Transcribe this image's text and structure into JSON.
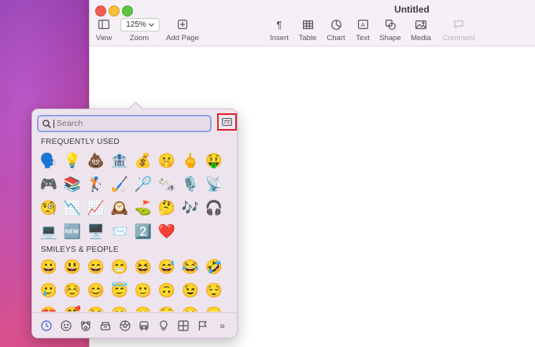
{
  "window": {
    "title": "Untitled"
  },
  "toolbar": {
    "view_label": "View",
    "zoom_value": "125%",
    "zoom_label": "Zoom",
    "add_page_label": "Add Page",
    "insert_label": "Insert",
    "table_label": "Table",
    "chart_label": "Chart",
    "text_label": "Text",
    "shape_label": "Shape",
    "media_label": "Media",
    "comment_label": "Comment"
  },
  "picker": {
    "search_placeholder": "Search",
    "frequently_used_header": "FREQUENTLY USED",
    "smileys_header": "SMILEYS & PEOPLE",
    "frequently_used": [
      "🗣️",
      "💡",
      "💩",
      "🏦",
      "💰",
      "🤫",
      "🖕",
      "🤑",
      "🎮",
      "📚",
      "🏌️",
      "🏑",
      "🏸",
      "🗞️",
      "🎙️",
      "📡",
      "🧐",
      "📉",
      "📈",
      "🕰️",
      "⛳",
      "🤔",
      "🎶",
      "🎧",
      "💻",
      "🆕",
      "🖥️",
      "📨",
      "2️⃣",
      "❤️"
    ],
    "smileys": [
      "😀",
      "😃",
      "😄",
      "😁",
      "😆",
      "😅",
      "😂",
      "🤣",
      "🥲",
      "☺️",
      "😊",
      "😇",
      "🙂",
      "🙃",
      "😉",
      "😌",
      "😍",
      "🥰",
      "😘",
      "😗",
      "😙",
      "😚",
      "😋",
      "😛"
    ],
    "categories": [
      "clock-icon",
      "smiley-icon",
      "bear-icon",
      "food-icon",
      "ball-icon",
      "car-icon",
      "bulb-icon",
      "symbols-icon",
      "flag-icon"
    ],
    "more_label": "»",
    "selected_category": "clock-icon",
    "highlight_color": "#e02222",
    "search_border_color": "#8ea2e8"
  }
}
